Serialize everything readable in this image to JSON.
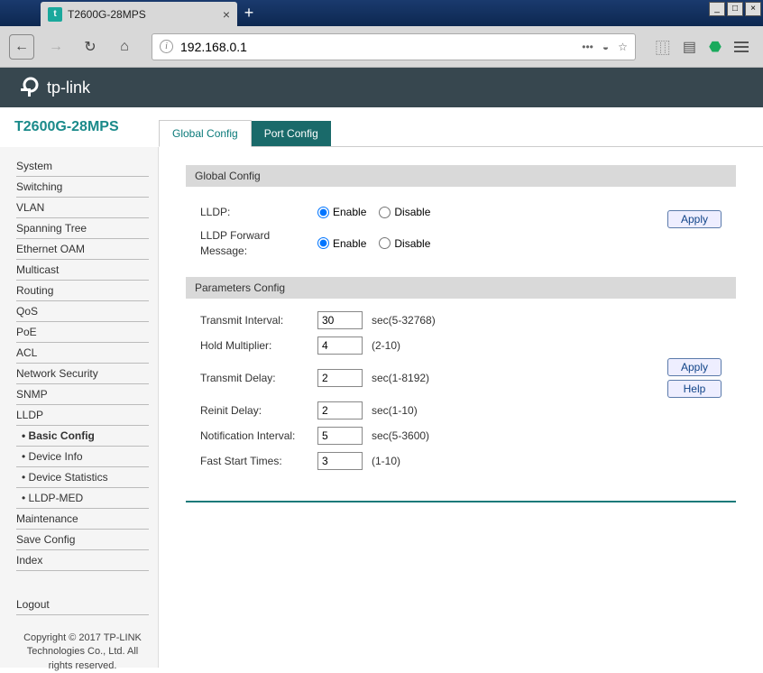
{
  "browser": {
    "tab_title": "T2600G-28MPS",
    "url": "192.168.0.1"
  },
  "header": {
    "brand": "tp-link"
  },
  "model": "T2600G-28MPS",
  "tabs": {
    "active": "Global Config",
    "inactive": "Port Config"
  },
  "sidebar": {
    "items": [
      "System",
      "Switching",
      "VLAN",
      "Spanning Tree",
      "Ethernet OAM",
      "Multicast",
      "Routing",
      "QoS",
      "PoE",
      "ACL",
      "Network Security",
      "SNMP",
      "LLDP"
    ],
    "subitems": [
      "Basic Config",
      "Device Info",
      "Device Statistics",
      "LLDP-MED"
    ],
    "items2": [
      "Maintenance",
      "Save Config",
      "Index"
    ],
    "logout": "Logout",
    "copyright": "Copyright © 2017\nTP-LINK Technologies Co., Ltd. All rights reserved."
  },
  "global_config": {
    "title": "Global Config",
    "lldp_label": "LLDP:",
    "forward_label": "LLDP Forward Message:",
    "enable": "Enable",
    "disable": "Disable",
    "apply": "Apply"
  },
  "params": {
    "title": "Parameters Config",
    "rows": [
      {
        "label": "Transmit Interval:",
        "value": "30",
        "hint": "sec(5-32768)"
      },
      {
        "label": "Hold Multiplier:",
        "value": "4",
        "hint": "(2-10)"
      },
      {
        "label": "Transmit Delay:",
        "value": "2",
        "hint": "sec(1-8192)"
      },
      {
        "label": "Reinit Delay:",
        "value": "2",
        "hint": "sec(1-10)"
      },
      {
        "label": "Notification Interval:",
        "value": "5",
        "hint": "sec(5-3600)"
      },
      {
        "label": "Fast Start Times:",
        "value": "3",
        "hint": "(1-10)"
      }
    ],
    "apply": "Apply",
    "help": "Help"
  }
}
